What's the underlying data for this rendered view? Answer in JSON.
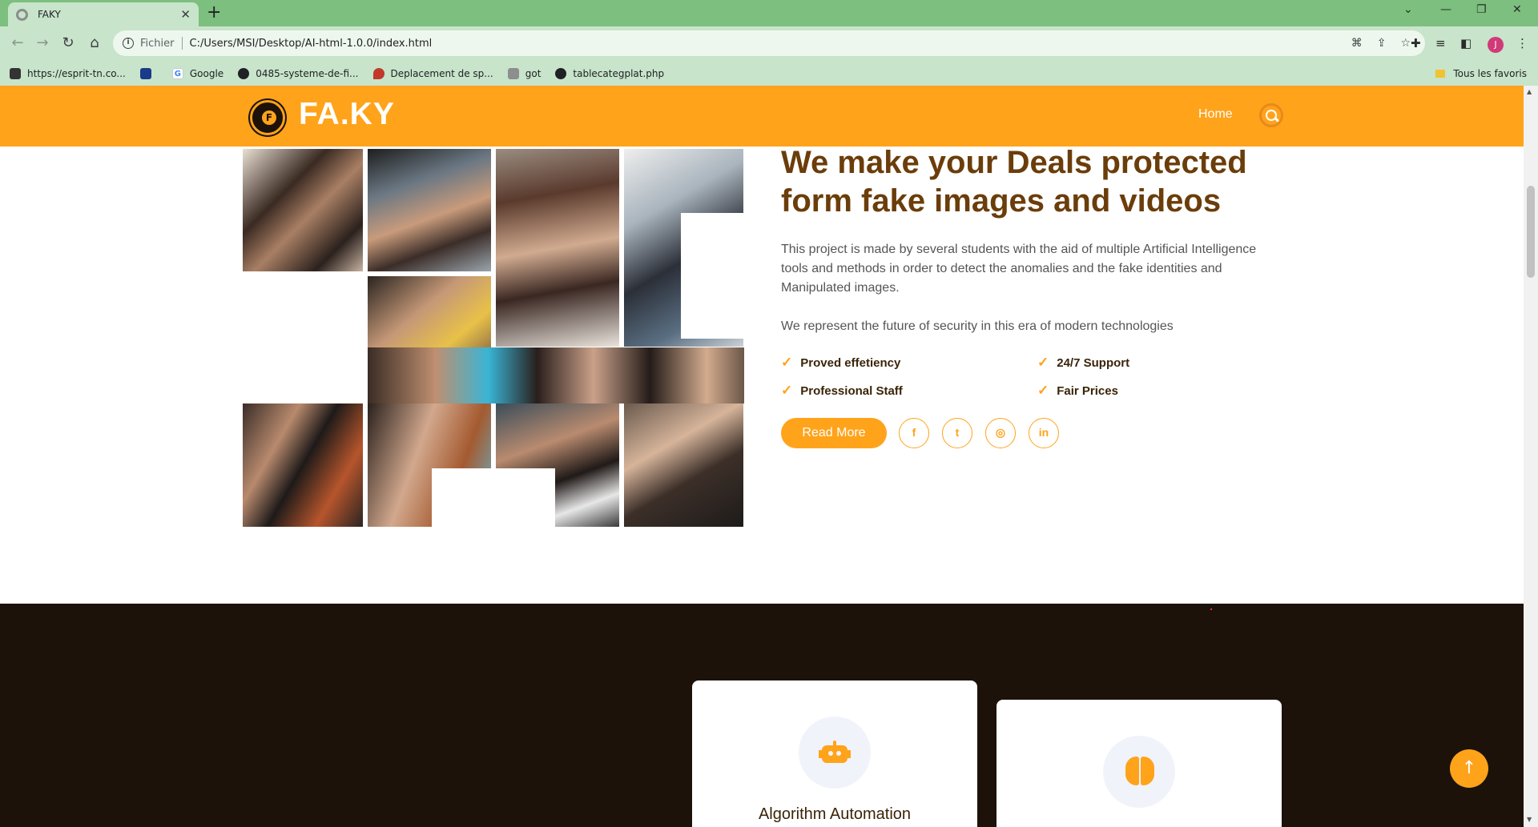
{
  "browser": {
    "tab_title": "FAKY",
    "url_scheme": "Fichier",
    "url": "C:/Users/MSI/Desktop/AI-html-1.0.0/index.html",
    "bookmarks": [
      {
        "label": "https://esprit-tn.co...",
        "icon": "esprit-favicon",
        "color": "#333333"
      },
      {
        "label": "",
        "icon": "feather-favicon",
        "color": "#1a3a8a"
      },
      {
        "label": "Google",
        "icon": "google-favicon",
        "color": "#4285f4"
      },
      {
        "label": "0485-systeme-de-fi...",
        "icon": "globe-favicon",
        "color": "#202124"
      },
      {
        "label": "Deplacement de sp...",
        "icon": "flame-favicon",
        "color": "#c0392b"
      },
      {
        "label": "got",
        "icon": "site-favicon",
        "color": "#8e8e8e"
      },
      {
        "label": "tablecategplat.php",
        "icon": "globe-favicon",
        "color": "#202124"
      }
    ],
    "all_bookmarks_label": "Tous les favoris",
    "profile_initial": "J"
  },
  "site": {
    "logo_text": "FA.KY",
    "nav_home": "Home"
  },
  "about": {
    "title": "We make your Deals protected form fake images and videos",
    "paragraph1": "This project is made by several students with the aid of multiple Artificial Intelligence tools and methods in order to detect the anomalies and the fake identities and Manipulated images.",
    "paragraph2": "We represent the future of security in this era of modern technologies",
    "features": [
      "Proved effetiency",
      "24/7 Support",
      "Professional Staff",
      "Fair Prices"
    ],
    "read_more": "Read More",
    "social": [
      "facebook-icon",
      "twitter-icon",
      "instagram-icon",
      "linkedin-icon"
    ]
  },
  "services": {
    "cards": [
      {
        "title": "Algorithm Automation",
        "icon": "robot-icon"
      },
      {
        "title": "",
        "icon": "brain-icon"
      }
    ]
  },
  "colors": {
    "accent": "#ffa31a",
    "dark": "#1c1209",
    "heading": "#6b3d0a",
    "browser_frame": "#7cbf7e"
  }
}
